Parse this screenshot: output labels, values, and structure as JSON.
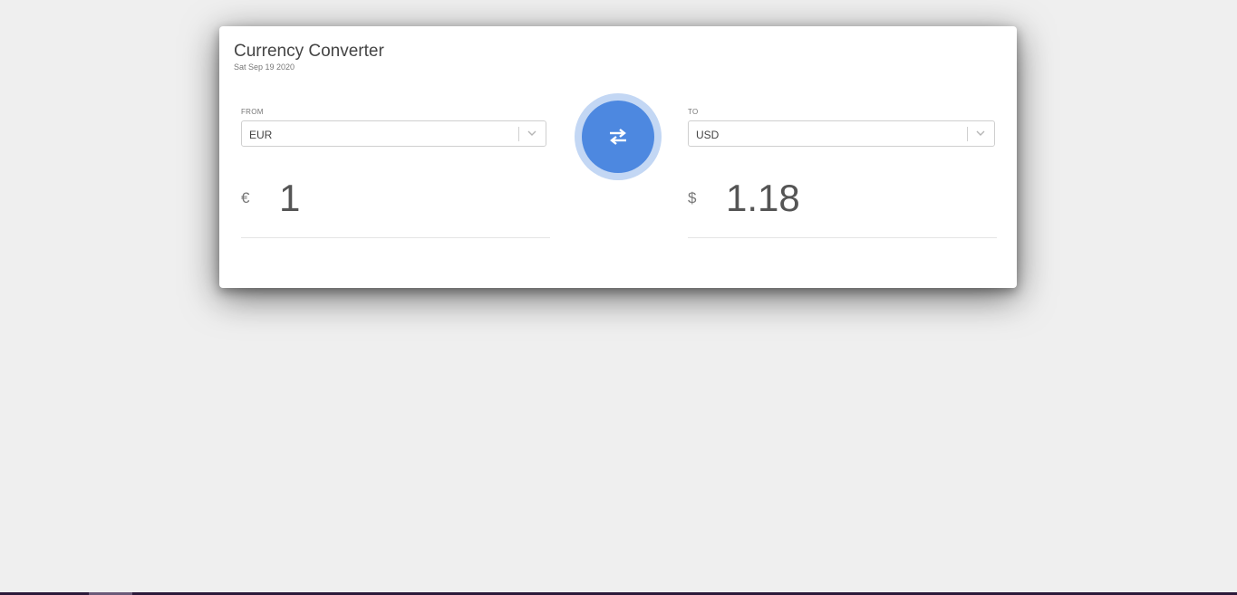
{
  "converter": {
    "title": "Currency Converter",
    "date": "Sat Sep 19 2020",
    "from": {
      "label": "FROM",
      "currency": "EUR",
      "symbol": "€",
      "amount": "1"
    },
    "to": {
      "label": "TO",
      "currency": "USD",
      "symbol": "$",
      "amount": "1.18"
    },
    "swap_icon": "swap-arrows-icon"
  },
  "colors": {
    "background": "#efefef",
    "card": "#ffffff",
    "accent": "#4d88e0",
    "accent_ring": "#c3d7f4"
  }
}
